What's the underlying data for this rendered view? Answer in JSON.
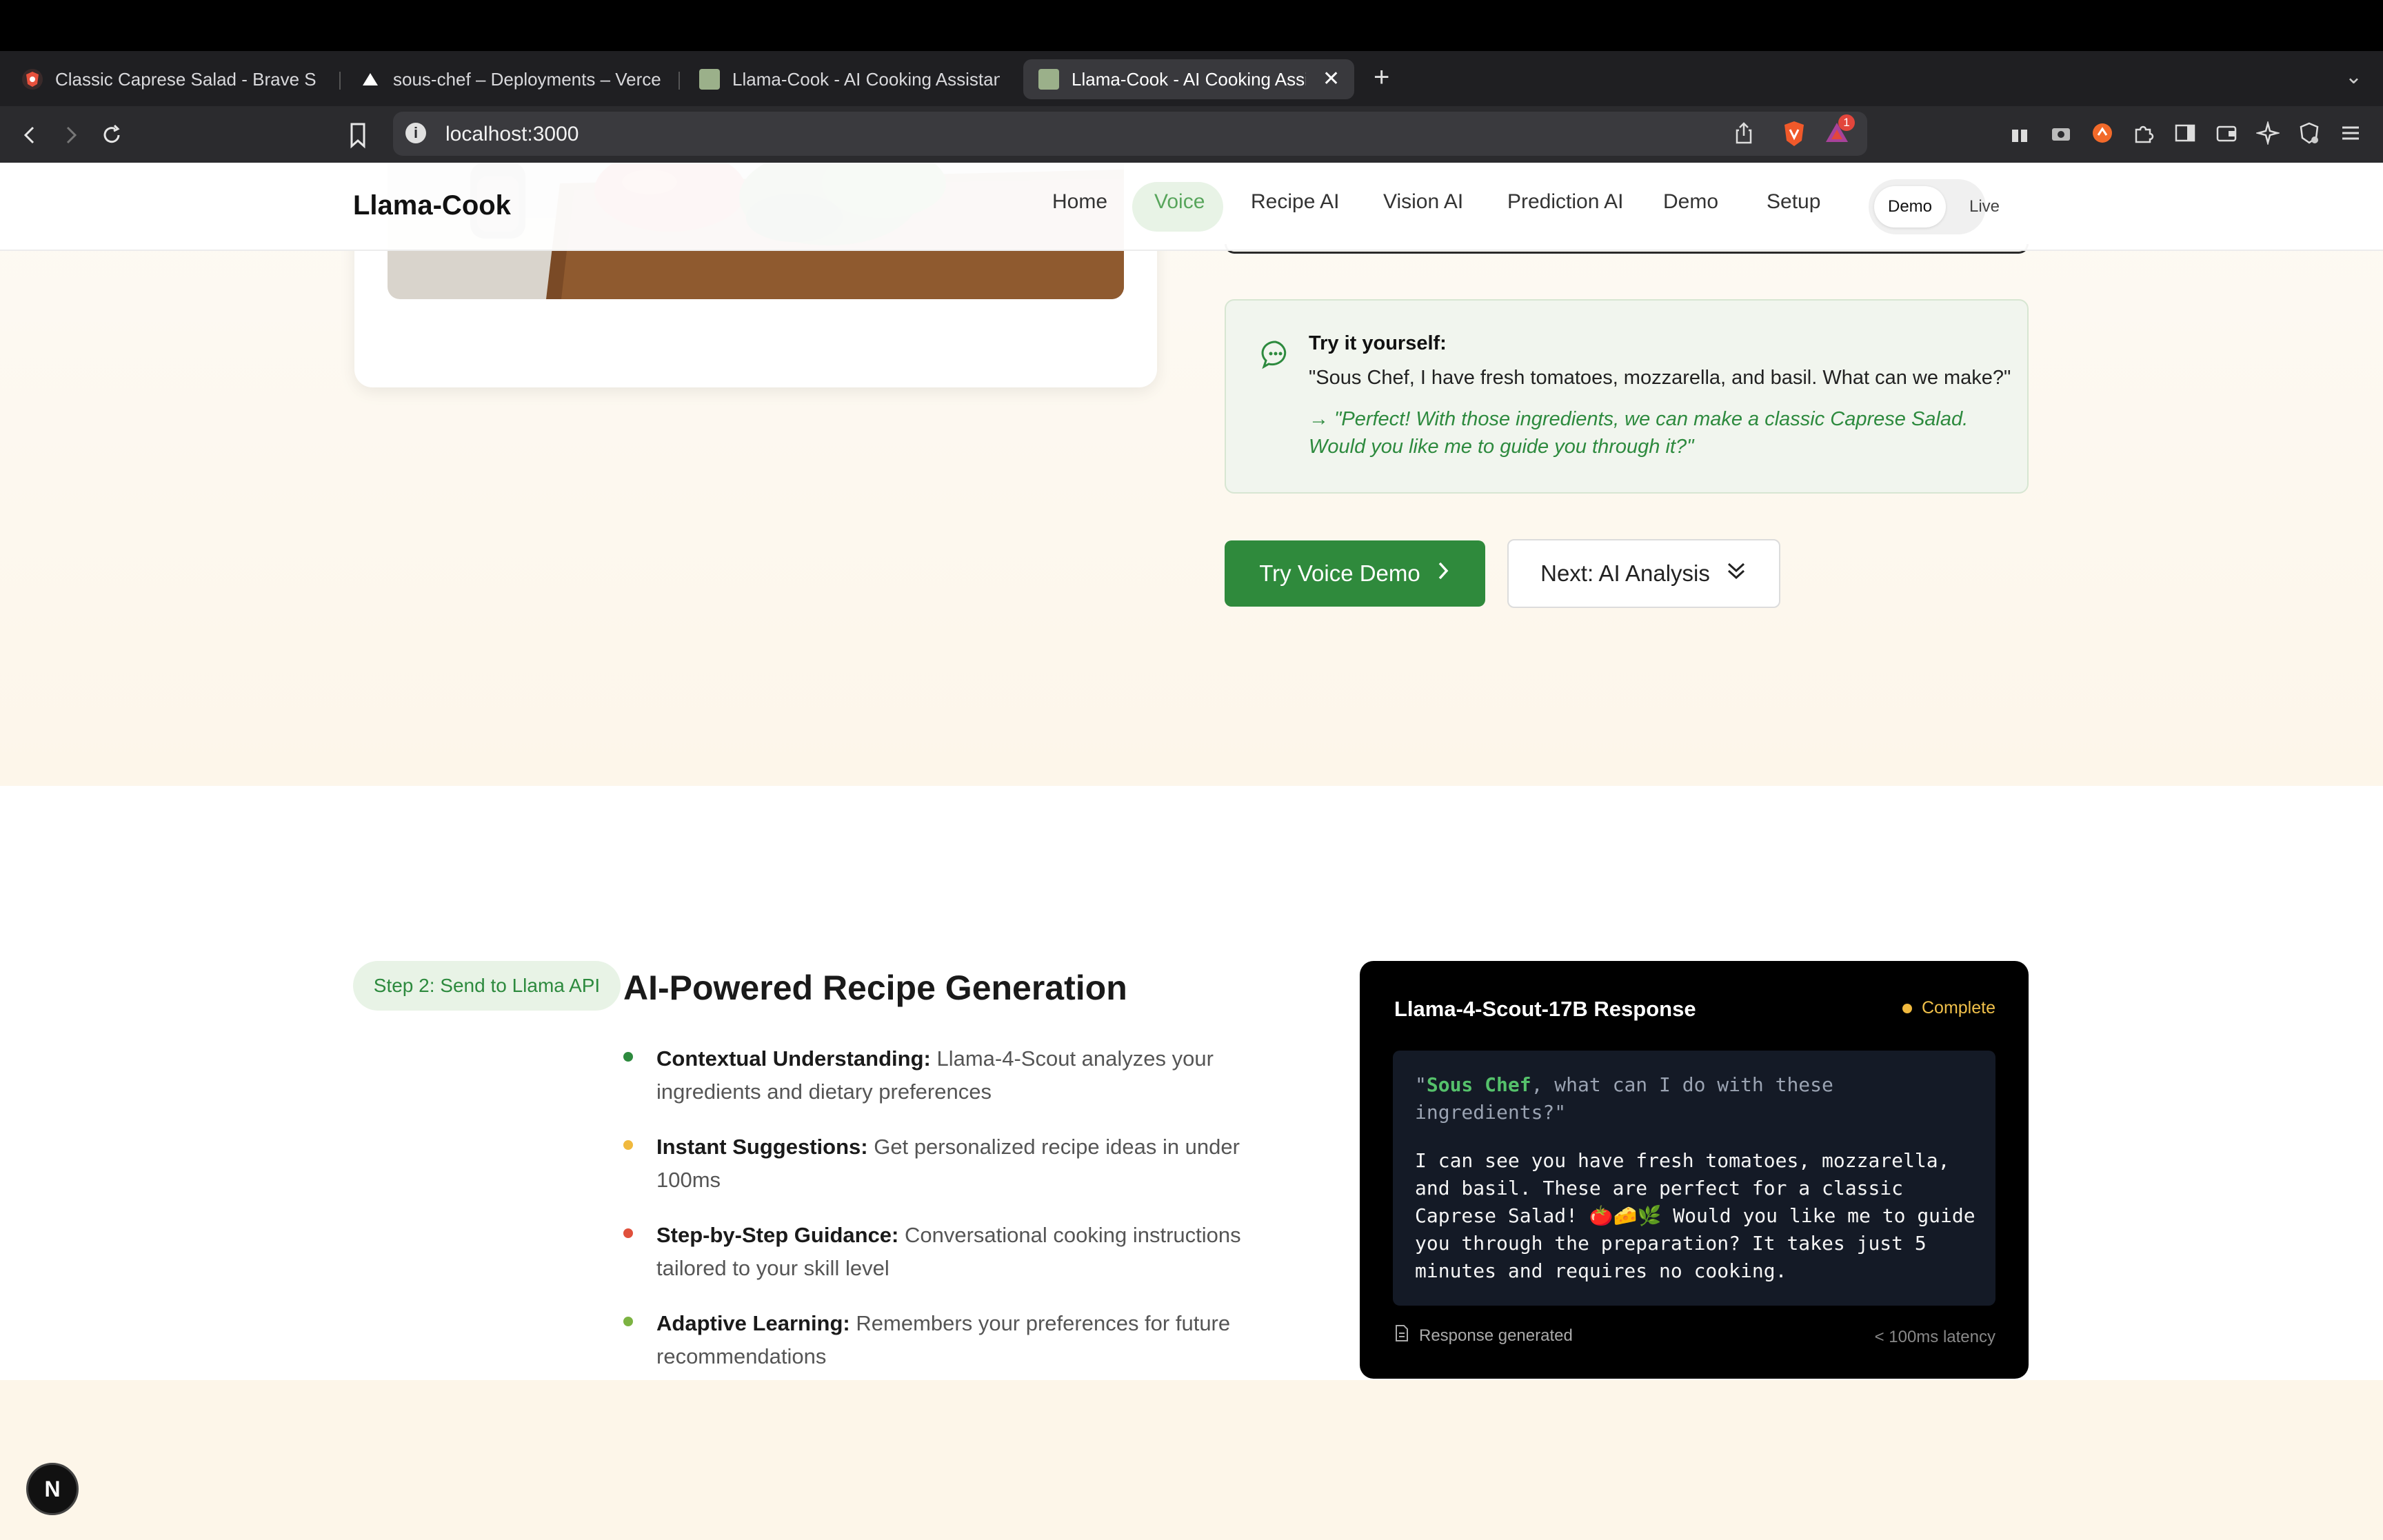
{
  "browser": {
    "tabs": [
      {
        "title": "Classic Caprese Salad - Brave Search",
        "icon": "brave-search-icon",
        "active": false
      },
      {
        "title": "sous-chef – Deployments – Vercel",
        "icon": "vercel-icon",
        "active": false
      },
      {
        "title": "Llama-Cook - AI Cooking Assistant",
        "icon": "llama-cook-favicon",
        "active": false
      },
      {
        "title": "Llama-Cook - AI Cooking Assistant",
        "icon": "llama-cook-favicon",
        "active": true
      }
    ],
    "url": "localhost:3000",
    "rewards_count": "1"
  },
  "site": {
    "brand": "Llama-Cook",
    "nav": [
      "Home",
      "Voice",
      "Recipe AI",
      "Vision AI",
      "Prediction AI",
      "Demo",
      "Setup"
    ],
    "active_nav": "Voice",
    "mode": {
      "demo": "Demo",
      "live": "Live",
      "selected": "Demo"
    }
  },
  "voice_section": {
    "try": {
      "title": "Try it yourself:",
      "quote": "\"Sous Chef, I have fresh tomatoes, mozzarella, and basil. What can we make?\"",
      "answer": "→ \"Perfect! With those ingredients, we can make a classic Caprese Salad. Would you like me to guide you through it?\""
    },
    "primary_button": "Try Voice Demo",
    "secondary_button": "Next: AI Analysis"
  },
  "recipe_section": {
    "step": "Step 2: Send to Llama API",
    "title": "AI-Powered Recipe Generation",
    "features": [
      {
        "label": "Contextual Understanding:",
        "text": "Llama-4-Scout analyzes your ingredients and dietary preferences",
        "color": "#2d8a3e"
      },
      {
        "label": "Instant Suggestions:",
        "text": "Get personalized recipe ideas in under 100ms",
        "color": "#f0b93e"
      },
      {
        "label": "Step-by-Step Guidance:",
        "text": "Conversational cooking instructions tailored to your skill level",
        "color": "#e0503c"
      },
      {
        "label": "Adaptive Learning:",
        "text": "Remembers your preferences for future recommendations",
        "color": "#7cb342"
      }
    ],
    "response": {
      "title": "Llama-4-Scout-17B Response",
      "status": "Complete",
      "prompt_open": "\"",
      "prompt_highlight": "Sous Chef",
      "prompt_rest": ", what can I do with these ingredients?\"",
      "answer": "I can see you have fresh tomatoes, mozzarella, and basil. These are perfect for a classic Caprese Salad! 🍅🧀🌿 Would you like me to guide you through the preparation? It takes just 5 minutes and requires no cooking.",
      "footer_left": "Response generated",
      "footer_right": "< 100ms latency"
    }
  },
  "dev_badge": "N"
}
